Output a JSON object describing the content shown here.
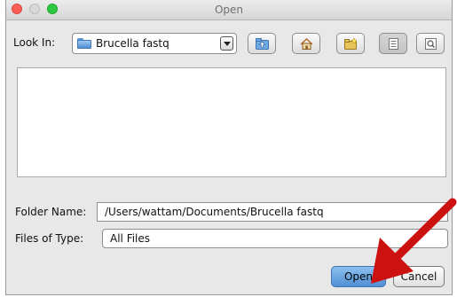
{
  "window": {
    "title": "Open"
  },
  "lookin": {
    "label": "Look In:",
    "value": "Brucella fastq"
  },
  "toolbar": {
    "icons": [
      "up-folder-icon",
      "home-icon",
      "new-folder-icon",
      "list-view-icon",
      "details-view-icon"
    ]
  },
  "folder_name": {
    "label": "Folder Name:",
    "value": "/Users/wattam/Documents/Brucella fastq"
  },
  "files_of_type": {
    "label": "Files of Type:",
    "value": "All Files"
  },
  "buttons": {
    "open": "Open",
    "cancel": "Cancel"
  },
  "colors": {
    "annotation_arrow": "#cc1111",
    "default_button": "#5a98d6"
  }
}
